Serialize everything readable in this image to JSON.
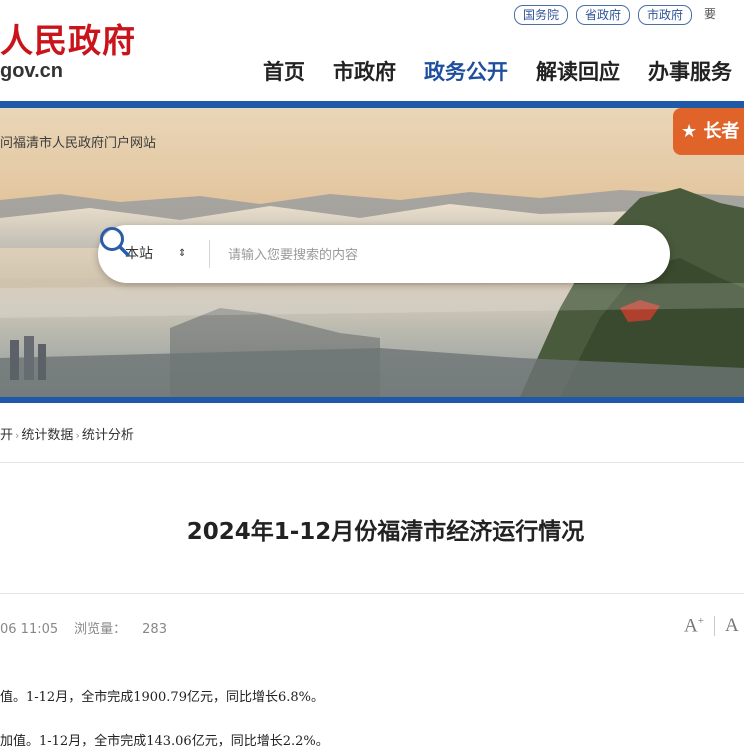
{
  "header": {
    "logo_title": "人民政府",
    "logo_domain": "gov.cn",
    "top_links": [
      "国务院",
      "省政府",
      "市政府"
    ],
    "top_link_cut": "要",
    "nav": [
      {
        "label": "首页"
      },
      {
        "label": "市政府"
      },
      {
        "label": "政务公开",
        "active": true
      },
      {
        "label": "解读回应"
      },
      {
        "label": "办事服务"
      }
    ]
  },
  "banner": {
    "welcome": "问福清市人民政府门户网站",
    "care_button": "长者",
    "search": {
      "scope": "本站",
      "placeholder": "请输入您要搜索的内容"
    }
  },
  "breadcrumb": [
    "开",
    "统计数据",
    "统计分析"
  ],
  "article": {
    "title": "2024年1-12月份福清市经济运行情况",
    "date": "06 11:05",
    "views_label": "浏览量：",
    "views": "283",
    "font_large": "A",
    "font_small": "A",
    "paragraphs": [
      "值。1-12月，全市完成1900.79亿元，同比增长6.8%。",
      "加值。1-12月，全市完成143.06亿元，同比增长2.2%。"
    ]
  },
  "colors": {
    "brand_red": "#c8141a",
    "nav_blue": "#1d4f9e",
    "bar_blue": "#1e5aa8",
    "care_orange": "#e0642a"
  }
}
